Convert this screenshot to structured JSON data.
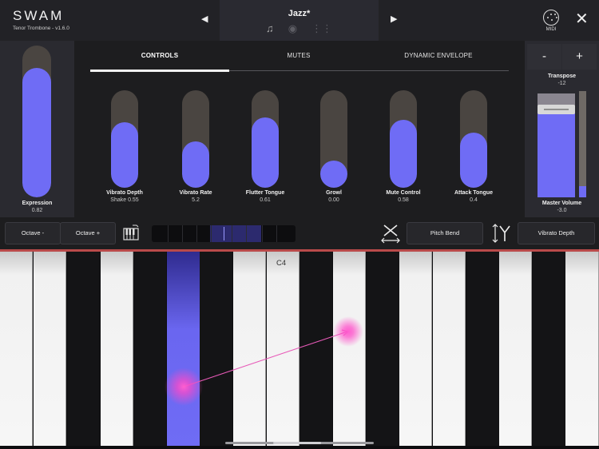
{
  "header": {
    "brand": "SWAM",
    "subtitle": "Tenor Trombone - v1.6.0",
    "preset": "Jazz*",
    "prev_icon": "triangle-left-icon",
    "next_icon": "triangle-right-icon",
    "midi_label": "MIDI",
    "close_icon": "close-icon"
  },
  "expression": {
    "label": "Expression",
    "value": "0.82",
    "level": 0.82
  },
  "tabs": [
    {
      "label": "CONTROLS",
      "active": true
    },
    {
      "label": "MUTES",
      "active": false
    },
    {
      "label": "DYNAMIC ENVELOPE",
      "active": false
    }
  ],
  "controls": [
    {
      "label": "Vibrato Depth",
      "value": "Shake 0.55",
      "level": 0.55
    },
    {
      "label": "Vibrato Rate",
      "value": "5.2",
      "level": 0.27
    },
    {
      "label": "Flutter Tongue",
      "value": "0.61",
      "level": 0.61
    },
    {
      "label": "Growl",
      "value": "0.00",
      "level": 0.0
    },
    {
      "label": "Mute Control",
      "value": "0.58",
      "level": 0.58
    },
    {
      "label": "Attack Tongue",
      "value": "0.4",
      "level": 0.4
    }
  ],
  "right": {
    "minus_label": "-",
    "plus_label": "+",
    "transpose_label": "Transpose",
    "transpose_value": "-12",
    "volume_label": "Master Volume",
    "volume_value": "-3.0",
    "volume_level": 0.88
  },
  "toolbar": {
    "octave_down": "Octave -",
    "octave_up": "Octave +",
    "pitch_bend": "Pitch Bend",
    "vibrato_depth": "Vibrato Depth"
  },
  "keyboard": {
    "note_label": "C4"
  },
  "colors": {
    "accent": "#6f6cf5",
    "track": "#4a4541",
    "panel": "#2a2a30",
    "background": "#1b1b1d",
    "touch": "#ff49c8"
  }
}
